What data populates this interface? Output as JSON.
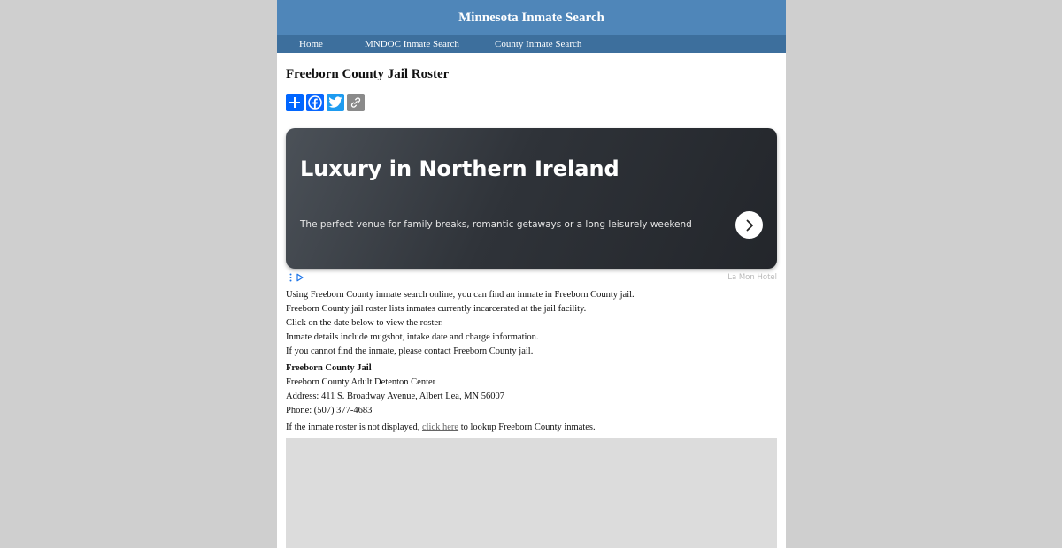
{
  "header": {
    "title": "Minnesota Inmate Search"
  },
  "nav": {
    "items": [
      {
        "label": "Home"
      },
      {
        "label": "MNDOC Inmate Search"
      },
      {
        "label": "County Inmate Search"
      }
    ]
  },
  "page": {
    "title": "Freeborn County Jail Roster"
  },
  "share": {
    "buttons": [
      {
        "icon": "plus-icon",
        "color": "#0166ff"
      },
      {
        "icon": "facebook-icon",
        "color": "#0866ff"
      },
      {
        "icon": "twitter-icon",
        "color": "#1d9bf0"
      },
      {
        "icon": "copy-link-icon",
        "color": "#8a8a8a"
      }
    ]
  },
  "ad": {
    "title": "Luxury in Northern Ireland",
    "description": "The perfect venue for family breaks, romantic getaways or a long leisurely weekend",
    "advertiser": "La Mon Hotel"
  },
  "intro": {
    "lines": [
      "Using Freeborn County inmate search online, you can find an inmate in Freeborn County jail.",
      "Freeborn County jail roster lists inmates currently incarcerated at the jail facility.",
      "Click on the date below to view the roster.",
      "Inmate details include mugshot, intake date and charge information.",
      "If you cannot find the inmate, please contact Freeborn County jail."
    ]
  },
  "jail": {
    "name": "Freeborn County Jail",
    "facility": "Freeborn County Adult Detenton Center",
    "address": "Address: 411 S. Broadway Avenue, Albert Lea, MN 56007",
    "phone": "Phone: (507) 377-4683"
  },
  "roster_note": {
    "before": "If the inmate roster is not displayed,",
    "link": "click here",
    "after": "to lookup Freeborn County inmates."
  }
}
